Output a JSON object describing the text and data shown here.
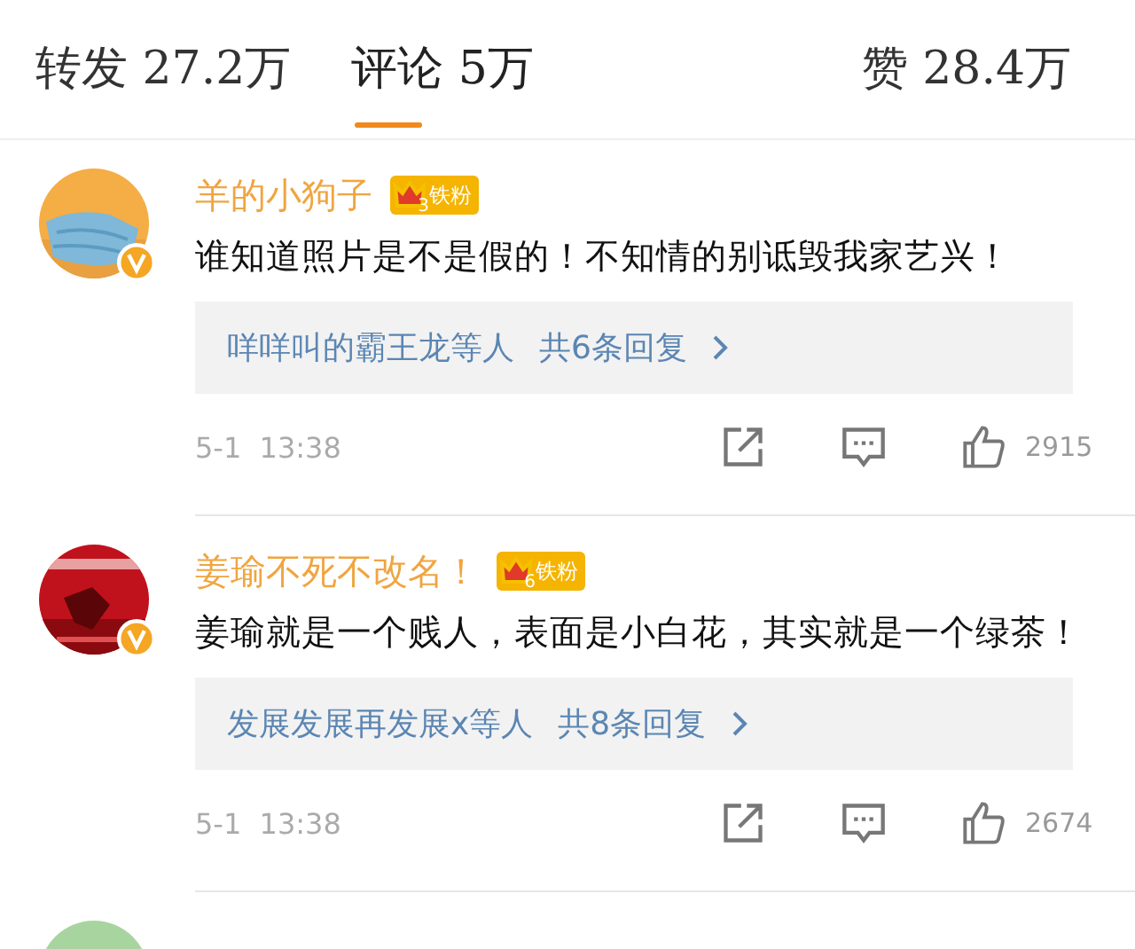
{
  "tabs": [
    {
      "kind": "reposts",
      "label": "转发 27.2万",
      "selected": false
    },
    {
      "kind": "comments",
      "label": "评论 5万",
      "selected": true
    },
    {
      "kind": "likes",
      "label": "赞 28.4万",
      "selected": false
    }
  ],
  "comments": [
    {
      "avatar": {
        "kind": "picture"
      },
      "name": "羊的小狗子",
      "badge": {
        "level": "3",
        "label": "铁粉"
      },
      "text": "谁知道照片是不是假的！不知情的别诋毁我家艺兴！",
      "replies": {
        "users": "咩咩叫的霸王龙等人",
        "count": "共6条回复"
      },
      "time": "5-1  13:38",
      "likes": "2915"
    },
    {
      "avatar": {
        "kind": "picture"
      },
      "name": "姜瑜不死不改名！",
      "badge": {
        "level": "6",
        "label": "铁粉"
      },
      "text": "姜瑜就是一个贱人，表面是小白花，其实就是一个绿茶！",
      "replies": {
        "users": "发展发展再发展x等人",
        "count": "共8条回复"
      },
      "time": "5-1  13:38",
      "likes": "2674"
    },
    {
      "avatar": {
        "kind": "picture"
      }
    }
  ]
}
